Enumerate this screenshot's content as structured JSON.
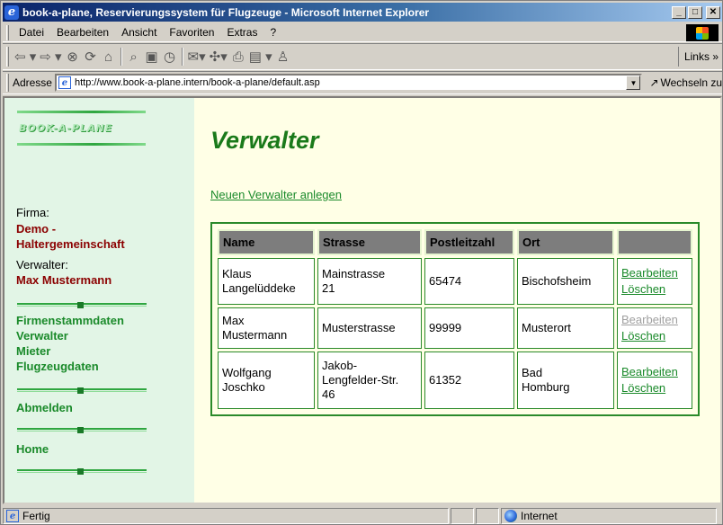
{
  "window": {
    "title": "book-a-plane, Reservierungssystem für Flugzeuge - Microsoft Internet Explorer"
  },
  "menu": [
    {
      "label": "Datei"
    },
    {
      "label": "Bearbeiten"
    },
    {
      "label": "Ansicht"
    },
    {
      "label": "Favoriten"
    },
    {
      "label": "Extras"
    },
    {
      "label": "?"
    }
  ],
  "toolbar": {
    "links_label": "Links »"
  },
  "address": {
    "label": "Adresse",
    "url": "http://www.book-a-plane.intern/book-a-plane/default.asp",
    "go_label": "Wechseln zu"
  },
  "sidebar": {
    "logo": "BOOK-A-PLANE",
    "firm_label": "Firma:",
    "firm_name_1": "Demo -",
    "firm_name_2": "Haltergemeinschaft",
    "admin_label": "Verwalter:",
    "admin_name": "Max Mustermann",
    "nav": [
      {
        "label": "Firmenstammdaten"
      },
      {
        "label": "Verwalter"
      },
      {
        "label": "Mieter"
      },
      {
        "label": "Flugzeugdaten"
      },
      {
        "label": "Abmelden"
      },
      {
        "label": "Home"
      }
    ]
  },
  "main": {
    "title": "Verwalter",
    "new_link": "Neuen Verwalter anlegen",
    "columns": [
      "Name",
      "Strasse",
      "Postleitzahl",
      "Ort",
      ""
    ],
    "rows": [
      {
        "name_1": "Klaus",
        "name_2": "Langelüddeke",
        "street_1": "Mainstrasse",
        "street_2": "21",
        "street_3": "",
        "zip": "65474",
        "city_1": "Bischofsheim",
        "city_2": "",
        "edit": "Bearbeiten",
        "edit_enabled": true,
        "delete": "Löschen"
      },
      {
        "name_1": "Max",
        "name_2": "Mustermann",
        "street_1": "Musterstrasse",
        "street_2": "",
        "street_3": "",
        "zip": "99999",
        "city_1": "Musterort",
        "city_2": "",
        "edit": "Bearbeiten",
        "edit_enabled": false,
        "delete": "Löschen"
      },
      {
        "name_1": "Wolfgang",
        "name_2": "Joschko",
        "street_1": "Jakob-",
        "street_2": "Lengfelder-Str.",
        "street_3": "46",
        "zip": "61352",
        "city_1": "Bad",
        "city_2": "Homburg",
        "edit": "Bearbeiten",
        "edit_enabled": true,
        "delete": "Löschen"
      }
    ]
  },
  "status": {
    "text": "Fertig",
    "zone": "Internet"
  },
  "colors": {
    "accent_green": "#1a8a2a",
    "name_red": "#8b0000",
    "sidebar_bg": "#e2f5e6",
    "page_bg": "#ffffe6",
    "titlebar": "#0a246a"
  }
}
